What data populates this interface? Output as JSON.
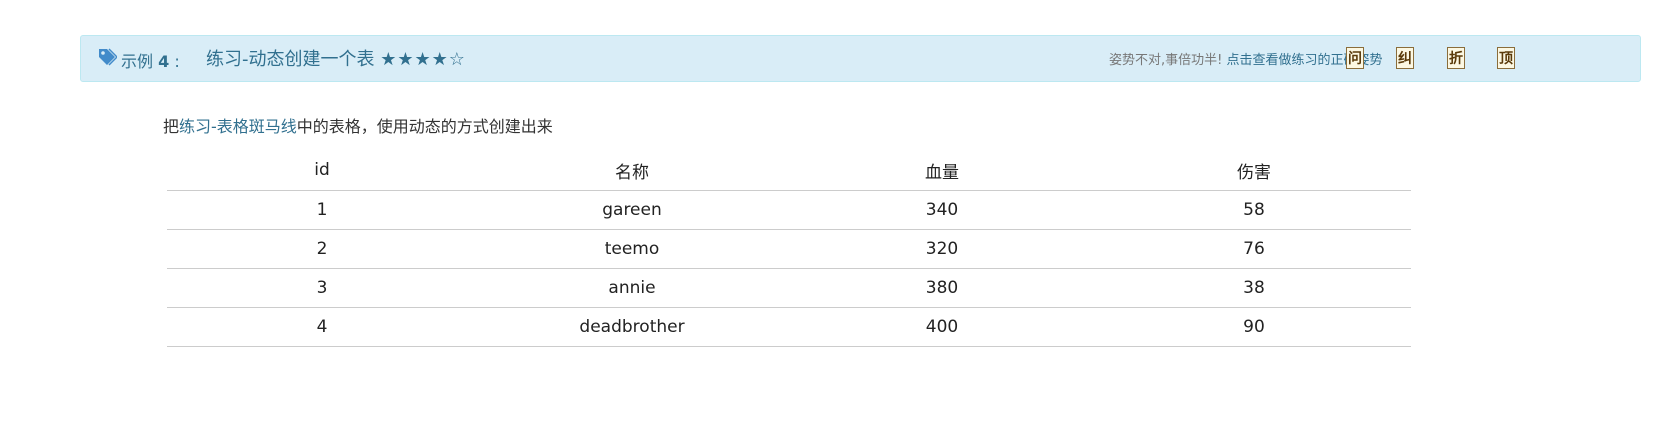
{
  "header": {
    "example_label": "示例",
    "example_number": "4",
    "example_separator": ":",
    "title": "练习-动态创建一个表",
    "stars": "★★★★☆",
    "hint_prefix": "姿势不对,事倍功半!",
    "hint_link": "点击查看做练习的正确姿势",
    "buttons": [
      {
        "label": "问"
      },
      {
        "label": "纠"
      },
      {
        "label": "折"
      },
      {
        "label": "顶"
      }
    ]
  },
  "description": {
    "prefix": "把",
    "link": "练习-表格斑马线",
    "suffix": "中的表格，使用动态的方式创建出来"
  },
  "table": {
    "headers": [
      "id",
      "名称",
      "血量",
      "伤害"
    ],
    "rows": [
      [
        "1",
        "gareen",
        "340",
        "58"
      ],
      [
        "2",
        "teemo",
        "320",
        "76"
      ],
      [
        "3",
        "annie",
        "380",
        "38"
      ],
      [
        "4",
        "deadbrother",
        "400",
        "90"
      ]
    ]
  },
  "colors": {
    "header_bg": "#d9edf7",
    "header_border": "#bce8f1",
    "accent": "#31708f"
  }
}
